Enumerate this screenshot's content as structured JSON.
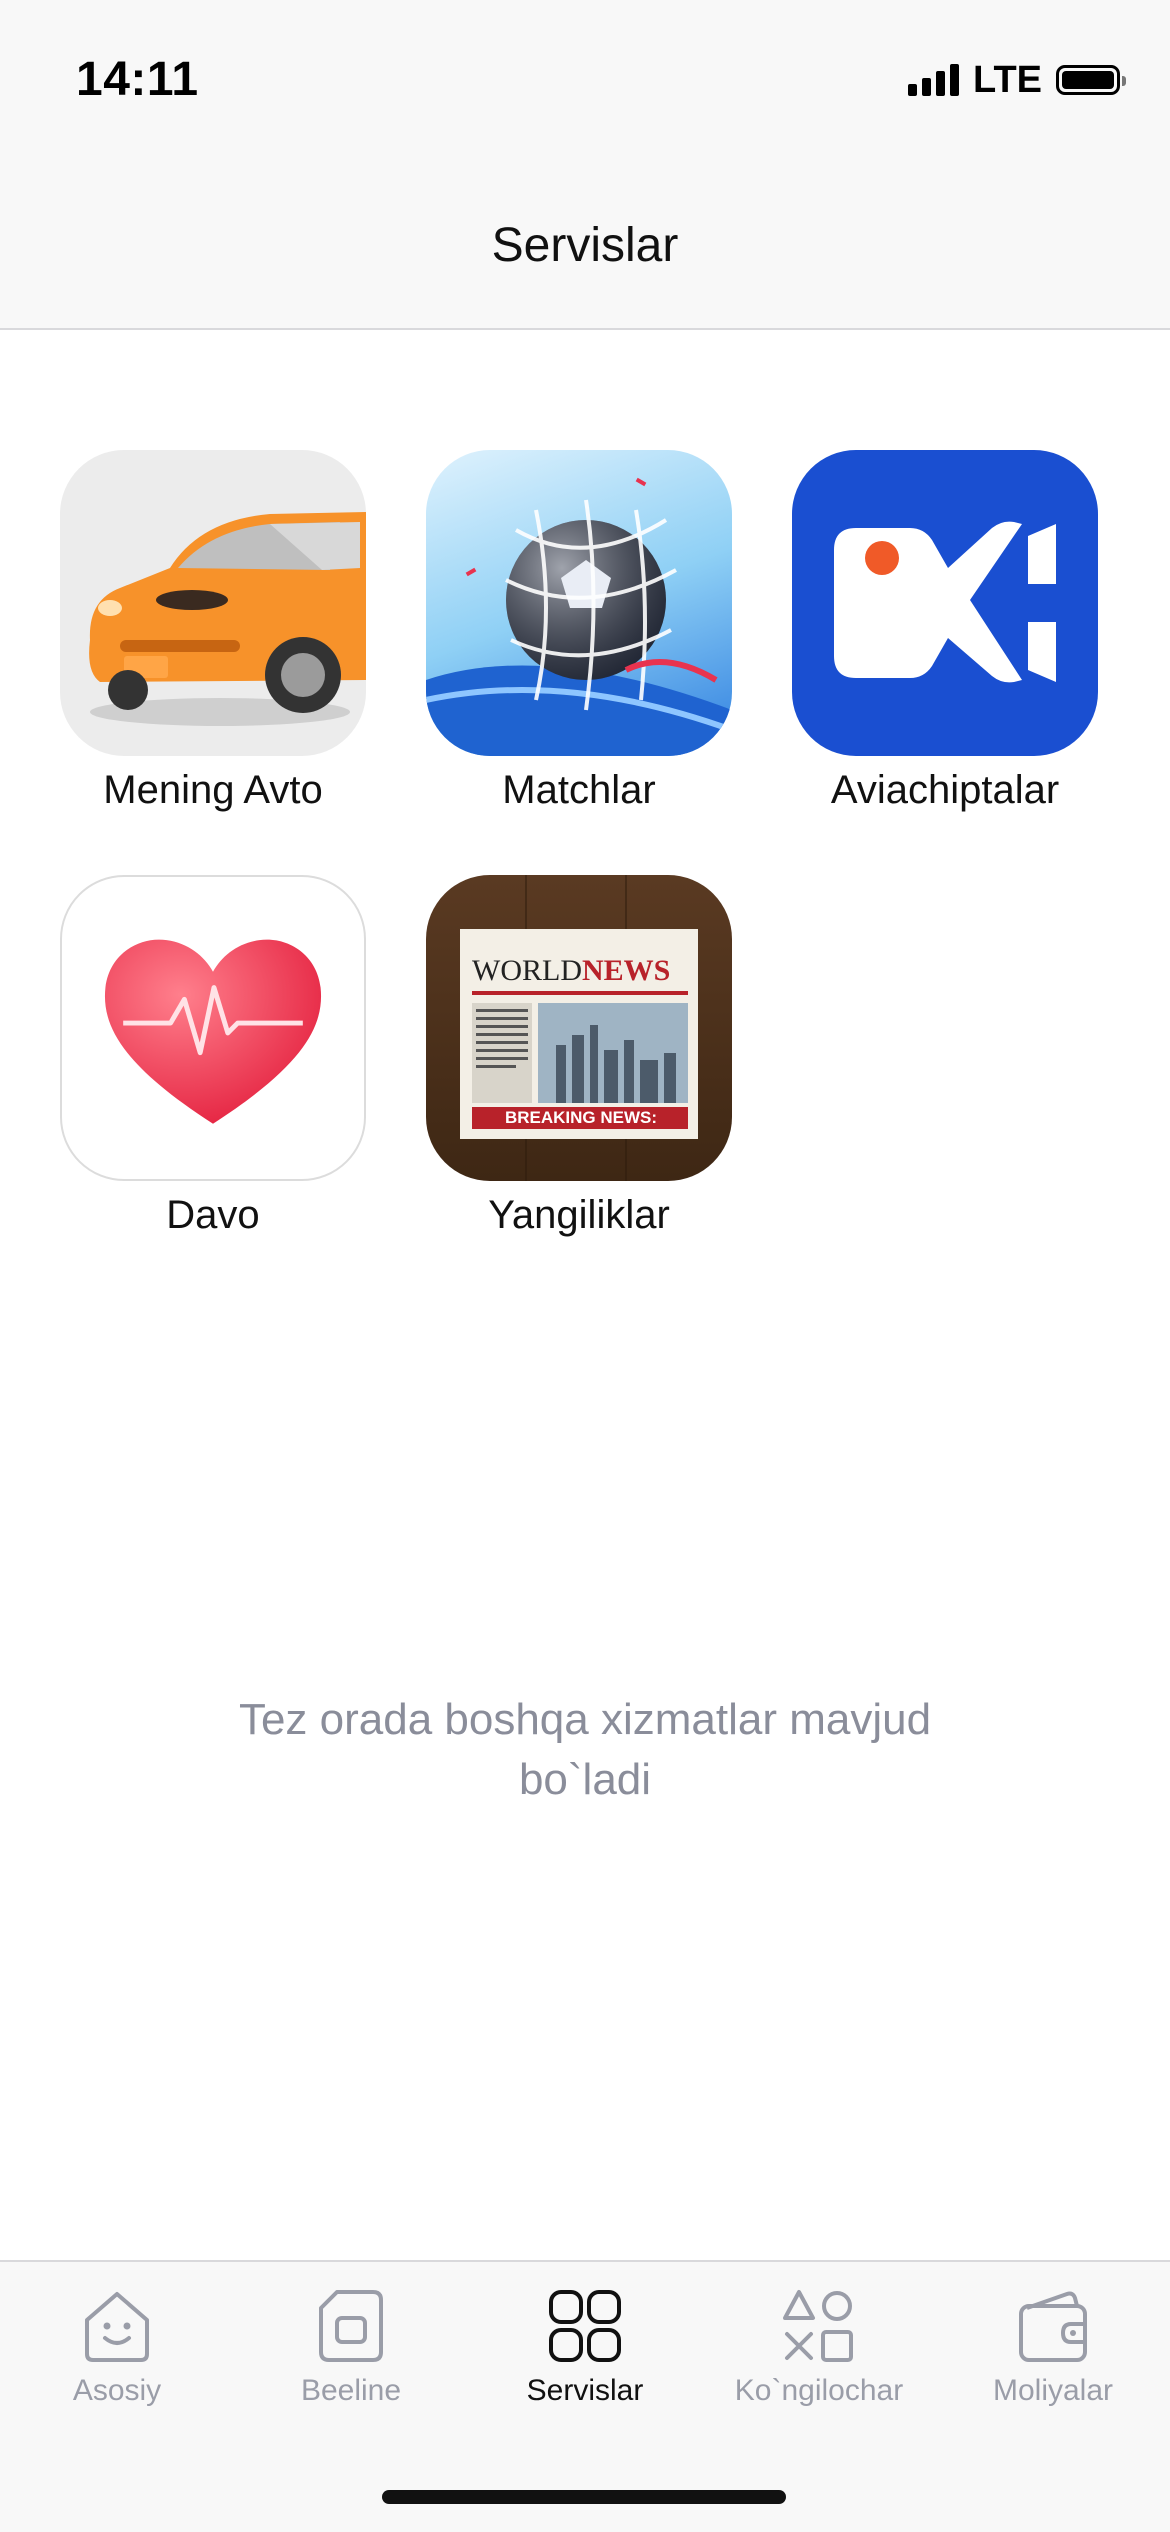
{
  "status_bar": {
    "time": "14:11",
    "network": "LTE"
  },
  "header": {
    "title": "Servislar"
  },
  "services": [
    {
      "label": "Mening Avto",
      "icon": "car-icon"
    },
    {
      "label": "Matchlar",
      "icon": "soccer-ball-icon"
    },
    {
      "label": "Aviachiptalar",
      "icon": "airplane-icon"
    },
    {
      "label": "Davo",
      "icon": "heart-pulse-icon"
    },
    {
      "label": "Yangiliklar",
      "icon": "newspaper-icon",
      "newspaper_title": "WORLD",
      "newspaper_title_accent": "NEWS",
      "newspaper_banner": "BREAKING NEWS:"
    }
  ],
  "coming_soon": {
    "line1": "Tez orada boshqa xizmatlar mavjud",
    "line2": "bo`ladi"
  },
  "tabs": [
    {
      "label": "Asosiy",
      "icon": "smiley-home-icon",
      "active": false
    },
    {
      "label": "Beeline",
      "icon": "sim-card-icon",
      "active": false
    },
    {
      "label": "Servislar",
      "icon": "grid-icon",
      "active": true
    },
    {
      "label": "Ko`ngilochar",
      "icon": "shapes-icon",
      "active": false
    },
    {
      "label": "Moliyalar",
      "icon": "wallet-icon",
      "active": false
    }
  ],
  "colors": {
    "accent": "#111111",
    "inactive": "#9a9da8",
    "aviachiptalar_bg": "#1a4fd1",
    "heart": "#f0384c"
  }
}
